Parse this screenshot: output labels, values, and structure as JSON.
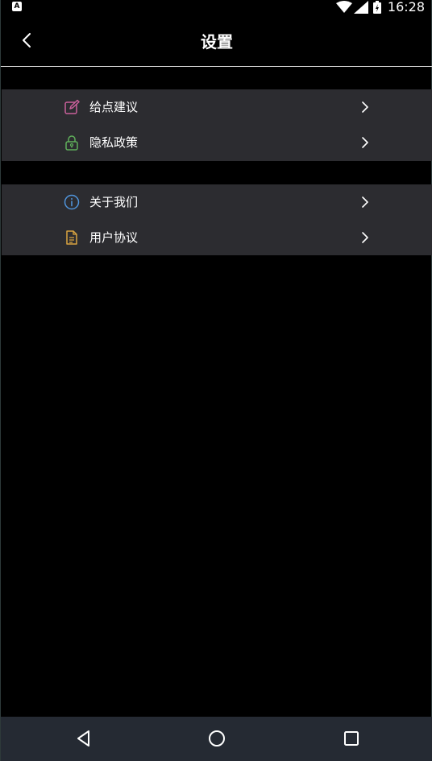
{
  "status_bar": {
    "time": "16:28",
    "notification_icon": "a-box-icon",
    "icons": [
      "wifi-icon",
      "signal-icon",
      "battery-charging-icon"
    ]
  },
  "header": {
    "title": "设置",
    "back_icon": "chevron-left-icon"
  },
  "groups": [
    {
      "items": [
        {
          "label": "给点建议",
          "icon": "edit-icon",
          "icon_color": "#c9609a"
        },
        {
          "label": "隐私政策",
          "icon": "lock-icon",
          "icon_color": "#5fae5a"
        }
      ]
    },
    {
      "items": [
        {
          "label": "关于我们",
          "icon": "info-icon",
          "icon_color": "#4f93d9"
        },
        {
          "label": "用户协议",
          "icon": "document-icon",
          "icon_color": "#d9a441"
        }
      ]
    }
  ],
  "colors": {
    "background": "#000000",
    "group_background": "#2c2c30",
    "nav_bar": "#252a33",
    "text": "#ffffff"
  },
  "nav_bar": {
    "icons": [
      "triangle-back-icon",
      "circle-home-icon",
      "square-recents-icon"
    ]
  }
}
